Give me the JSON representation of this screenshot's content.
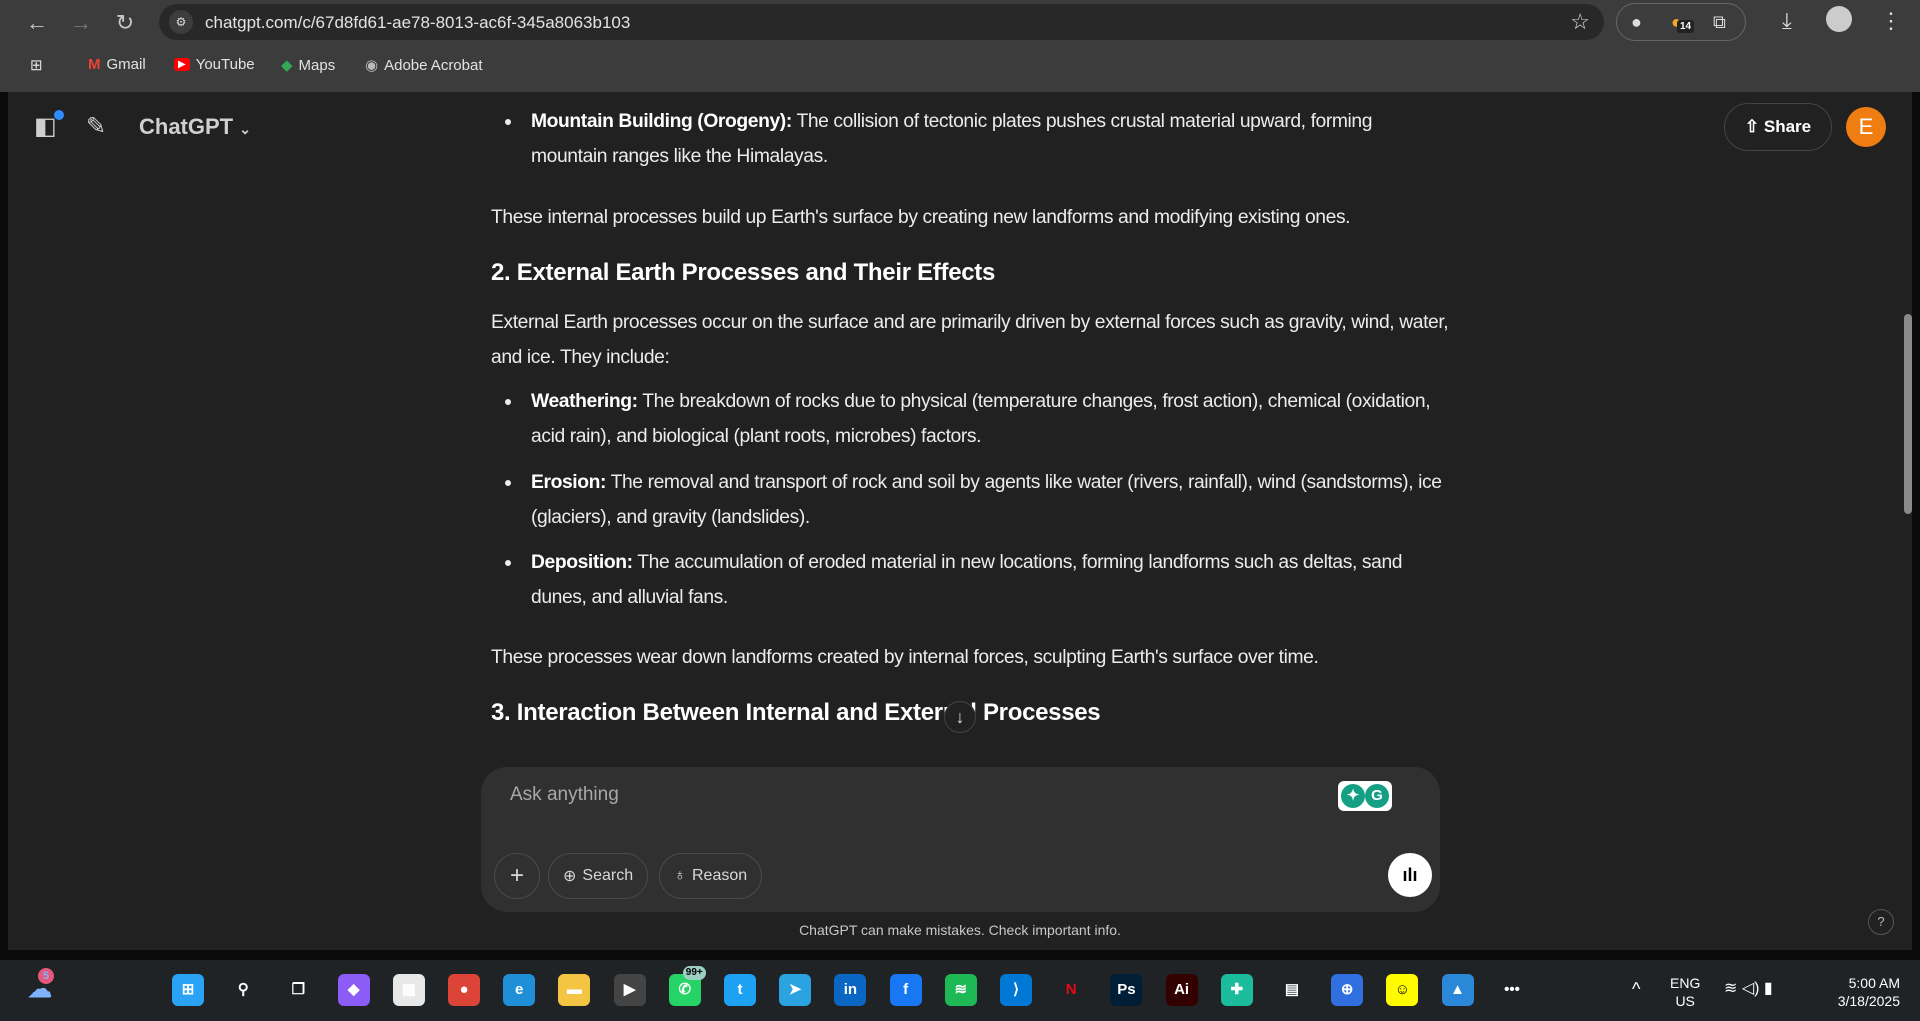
{
  "browser": {
    "url": "chatgpt.com/c/67d8fd61-ae78-8013-ac6f-345a8063b103",
    "ext_badge": "14",
    "bookmarks": [
      {
        "label": "Gmail",
        "icon": "gmail-icon",
        "color": "#ea4335"
      },
      {
        "label": "YouTube",
        "icon": "youtube-icon",
        "color": "#ff0000"
      },
      {
        "label": "Maps",
        "icon": "maps-icon",
        "color": "#34a853"
      },
      {
        "label": "Adobe Acrobat",
        "icon": "globe-icon",
        "color": "#bbbbbb"
      }
    ]
  },
  "app": {
    "title": "ChatGPT",
    "share_label": "Share",
    "avatar_letter": "E",
    "accent": "#f07d12"
  },
  "content": {
    "b1_title": "Mountain Building (Orogeny):",
    "b1_text": " The collision of tectonic plates pushes crustal material upward, forming mountain ranges like the Himalayas.",
    "p1": "These internal processes build up Earth's surface by creating new landforms and modifying existing ones.",
    "h2": "2. External Earth Processes and Their Effects",
    "p2": "External Earth processes occur on the surface and are primarily driven by external forces such as gravity, wind, water, and ice. They include:",
    "bullets": [
      {
        "title": "Weathering:",
        "text": " The breakdown of rocks due to physical (temperature changes, frost action), chemical (oxidation, acid rain), and biological (plant roots, microbes) factors."
      },
      {
        "title": "Erosion:",
        "text": " The removal and transport of rock and soil by agents like water (rivers, rainfall), wind (sandstorms), ice (glaciers), and gravity (landslides)."
      },
      {
        "title": "Deposition:",
        "text": " The accumulation of eroded material in new locations, forming landforms such as deltas, sand dunes, and alluvial fans."
      }
    ],
    "p3": "These processes wear down landforms created by internal forces, sculpting Earth's surface over time.",
    "h3": "3. Interaction Between Internal and External Processes"
  },
  "composer": {
    "placeholder": "Ask anything",
    "search_label": "Search",
    "reason_label": "Reason",
    "disclaimer": "ChatGPT can make mistakes. Check important info.",
    "help": "?"
  },
  "taskbar": {
    "weather_badge": "5",
    "whatsapp_badge": "99+",
    "lang": "ENG",
    "region": "US",
    "time": "5:00 AM",
    "date": "3/18/2025",
    "apps": [
      {
        "name": "start",
        "glyph": "⊞",
        "color": "#2aa3f5"
      },
      {
        "name": "search",
        "glyph": "⚲",
        "color": "transparent"
      },
      {
        "name": "task-view",
        "glyph": "❐",
        "color": "transparent"
      },
      {
        "name": "copilot",
        "glyph": "◆",
        "color": "#8b5cf6"
      },
      {
        "name": "store",
        "glyph": "▦",
        "color": "#e8e8e8"
      },
      {
        "name": "chrome",
        "glyph": "●",
        "color": "#db4437"
      },
      {
        "name": "edge",
        "glyph": "e",
        "color": "#1f8fd8"
      },
      {
        "name": "file-explorer",
        "glyph": "▬",
        "color": "#f4c443"
      },
      {
        "name": "media-player",
        "glyph": "▶",
        "color": "#444"
      },
      {
        "name": "whatsapp",
        "glyph": "✆",
        "color": "#25d366"
      },
      {
        "name": "twitter",
        "glyph": "t",
        "color": "#1da1f2"
      },
      {
        "name": "telegram",
        "glyph": "➤",
        "color": "#2aa3e0"
      },
      {
        "name": "linkedin",
        "glyph": "in",
        "color": "#0a66c2"
      },
      {
        "name": "facebook",
        "glyph": "f",
        "color": "#1877f2"
      },
      {
        "name": "spotify",
        "glyph": "≋",
        "color": "#1db954"
      },
      {
        "name": "vscode",
        "glyph": "⟩",
        "color": "#0078d4"
      },
      {
        "name": "netflix",
        "glyph": "N",
        "color": "transparent"
      },
      {
        "name": "photoshop",
        "glyph": "Ps",
        "color": "#001e36"
      },
      {
        "name": "illustrator",
        "glyph": "Ai",
        "color": "#330000"
      },
      {
        "name": "app-green",
        "glyph": "✚",
        "color": "#1abc9c"
      },
      {
        "name": "reader",
        "glyph": "▤",
        "color": "transparent"
      },
      {
        "name": "app-blue",
        "glyph": "⊕",
        "color": "#2f6fe0"
      },
      {
        "name": "snapchat",
        "glyph": "☺",
        "color": "#fffc00"
      },
      {
        "name": "photos",
        "glyph": "▲",
        "color": "#2b88d8"
      },
      {
        "name": "more",
        "glyph": "•••",
        "color": "transparent"
      }
    ]
  }
}
